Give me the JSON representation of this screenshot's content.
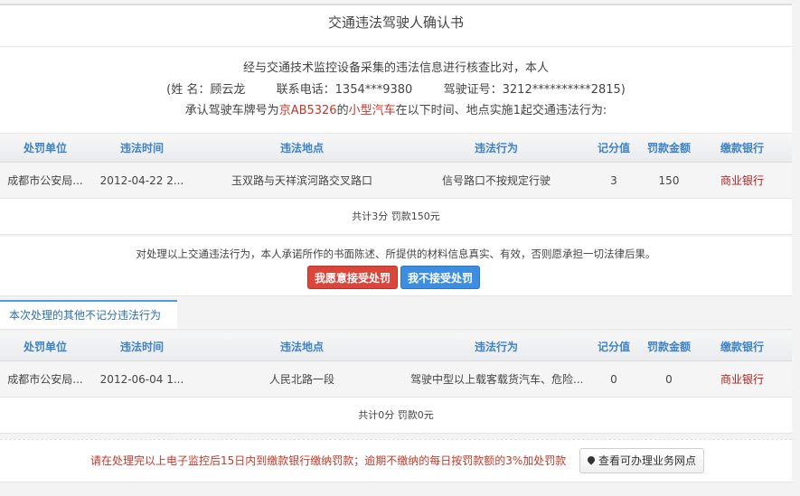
{
  "doc_title": "交通违法驾驶人确认书",
  "intro": {
    "line1": "经与交通技术监控设备采集的违法信息进行核查比对，本人",
    "name_label": "(姓 名：",
    "name": "顾云龙",
    "phone_label": "联系电话：",
    "phone": "1354***9380",
    "license_label": "驾驶证号：",
    "license": "3212**********2815)",
    "line3_prefix": "承认驾驶车牌号为",
    "plate": "京AB5326",
    "de": "的",
    "vehicle_type": "小型汽车",
    "line3_mid": "在以下时间、地点实施",
    "count": "1",
    "line3_suffix": "起交通违法行为:"
  },
  "columns": [
    "处罚单位",
    "违法时间",
    "违法地点",
    "违法行为",
    "记分值",
    "罚款金额",
    "缴款银行"
  ],
  "table1": {
    "rows": [
      {
        "unit": "成都市公安局...",
        "time": "2012-04-22 2...",
        "place": "玉双路与天祥滨河路交叉路口",
        "act": "信号路口不按规定行驶",
        "points": "3",
        "fine": "150",
        "bank": "商业银行"
      }
    ],
    "total": "共计3分 罚款150元"
  },
  "pledge": {
    "text": "对处理以上交通违法行为，本人承诺所作的书面陈述、所提供的材料信息真实、有效，否则愿承担一切法律后果。",
    "accept_label": "我愿意接受处罚",
    "reject_label": "我不接受处罚"
  },
  "section_label": "本次处理的其他不记分违法行为",
  "table2": {
    "rows": [
      {
        "unit": "成都市公安局...",
        "time": "2012-06-04 1...",
        "place": "人民北路一段",
        "act": "驾驶中型以上载客载货汽车、危险...",
        "points": "0",
        "fine": "0",
        "bank": "商业银行"
      }
    ],
    "total": "共计0分 罚款0元"
  },
  "footer": {
    "notice": "请在处理完以上电子监控后15日内到缴款银行缴纳罚款；逾期不缴纳的每日按罚款额的3%加处罚款",
    "map_button_label": "查看可办理业务网点"
  },
  "colors": {
    "header_blue": "#3e82c6",
    "accent_red": "#c0392b",
    "accept_red": "#d9463b",
    "reject_blue": "#3d8ee0"
  },
  "icons": {
    "map_button": "map-pin-icon"
  }
}
